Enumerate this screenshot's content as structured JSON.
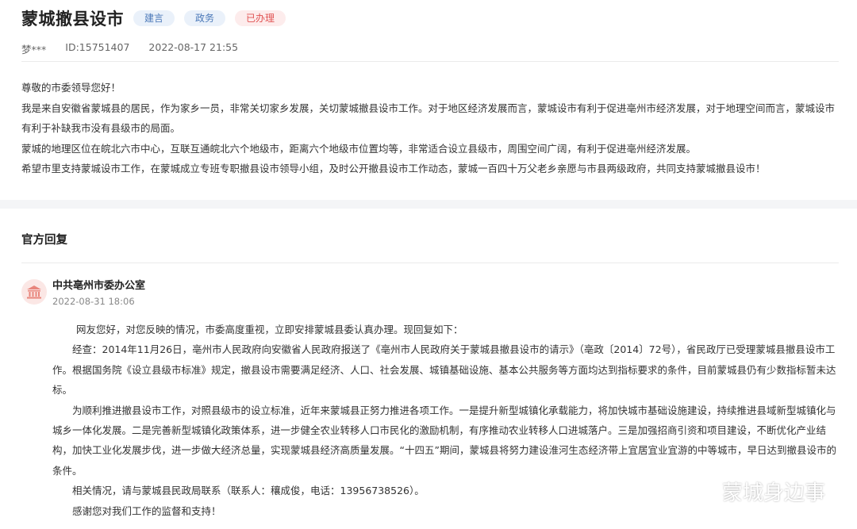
{
  "header": {
    "title": "蒙城撤县设市",
    "tags": [
      "建言",
      "政务",
      "已办理"
    ],
    "author": "梦***",
    "id": "ID:15751407",
    "datetime": "2022-08-17 21:55"
  },
  "message": {
    "paragraphs": [
      "尊敬的市委领导您好！",
      "我是来自安徽省蒙城县的居民，作为家乡一员，非常关切家乡发展，关切蒙城撤县设市工作。对于地区经济发展而言，蒙城设市有利于促进亳州市经济发展，对于地理空间而言，蒙城设市有利于补缺我市没有县级市的局面。",
      "蒙城的地理区位在皖北六市中心，互联互通皖北六个地级市，距离六个地级市位置均等，非常适合设立县级市，周围空间广阔，有利于促进亳州经济发展。",
      "希望市里支持蒙城设市工作，在蒙城成立专班专职撤县设市领导小组，及时公开撤县设市工作动态，蒙城一百四十万父老乡亲愿与市县两级政府，共同支持蒙城撤县设市！"
    ]
  },
  "reply": {
    "heading": "官方回复",
    "department": "中共亳州市委办公室",
    "datetime": "2022-08-31 18:06",
    "paragraphs": [
      "网友您好，对您反映的情况，市委高度重视，立即安排蒙城县委认真办理。现回复如下：",
      "经查：2014年11月26日，亳州市人民政府向安徽省人民政府报送了《亳州市人民政府关于蒙城县撤县设市的请示》（亳政〔2014〕72号），省民政厅已受理蒙城县撤县设市工作。根据国务院《设立县级市标准》规定，撤县设市需要满足经济、人口、社会发展、城镇基础设施、基本公共服务等方面均达到指标要求的条件，目前蒙城县仍有少数指标暂未达标。",
      "为顺利推进撤县设市工作，对照县级市的设立标准，近年来蒙城县正努力推进各项工作。一是提升新型城镇化承载能力，将加快城市基础设施建设，持续推进县域新型城镇化与城乡一体化发展。二是完善新型城镇化政策体系，进一步健全农业转移人口市民化的激励机制，有序推动农业转移人口进城落户。三是加强招商引资和项目建设，不断优化产业结构，加快工业化发展步伐，进一步做大经济总量，实现蒙城县经济高质量发展。“十四五”期间，蒙城县将努力建设淮河生态经济带上宜居宜业宜游的中等城市，早日达到撤县设市的条件。",
      "相关情况，请与蒙城县民政局联系（联系人：穰成俊，电话：13956738526）。",
      "感谢您对我们工作的监督和支持！"
    ]
  },
  "watermark": {
    "text": "蒙城身边事",
    "icon": "wechat-icon"
  },
  "colors": {
    "tag_blue_bg": "#eaf1fa",
    "tag_blue_text": "#4a78b8",
    "tag_red_bg": "#fdecec",
    "tag_red_text": "#e05252",
    "avatar_bg": "#fbe7e5",
    "avatar_icon": "#e8857c"
  }
}
